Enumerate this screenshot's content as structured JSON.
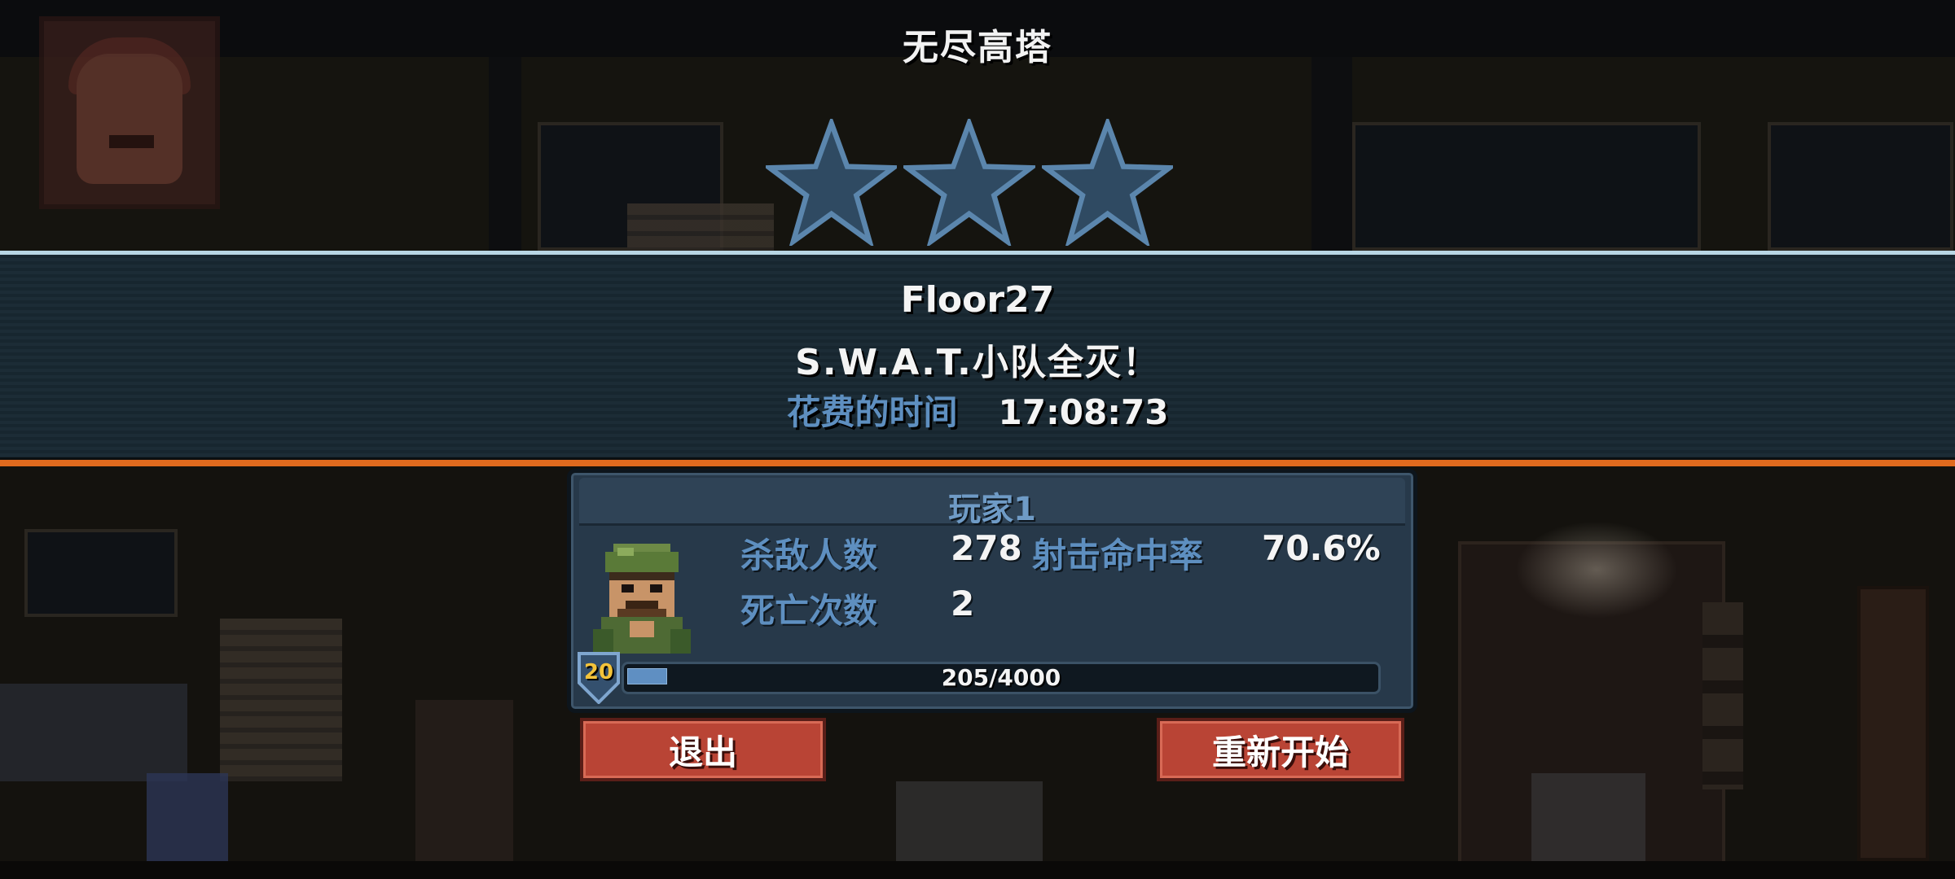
{
  "game": {
    "mode_title": "无尽高塔",
    "stars": {
      "earned": 0,
      "total": 3
    },
    "floor_label": "Floor27",
    "result_text": "S.W.A.T.小队全灭！",
    "time": {
      "label": "花费的时间",
      "value": "17:08:73"
    }
  },
  "player": {
    "name": "玩家1",
    "stats": {
      "kills_label": "杀敌人数",
      "kills_value": "278",
      "accuracy_label": "射击命中率",
      "accuracy_value": "70.6%",
      "deaths_label": "死亡次数",
      "deaths_value": "2"
    },
    "level": "20",
    "xp": {
      "current": 205,
      "max": 4000,
      "text": "205/4000"
    }
  },
  "buttons": {
    "exit_label": "退出",
    "restart_label": "重新开始"
  },
  "colors": {
    "accent_orange": "#e06a1e",
    "label_blue": "#5e8fc0",
    "button_red": "#b94435",
    "star_empty": "#2f4a62",
    "level_gold": "#f3c33a"
  },
  "icons": {
    "star": "star-icon",
    "avatar": "soldier-avatar",
    "level_badge": "shield-badge-icon"
  }
}
